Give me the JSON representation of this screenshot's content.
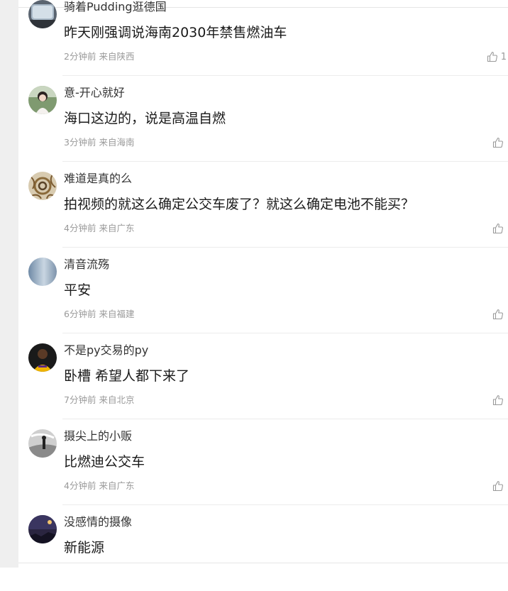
{
  "comments": [
    {
      "username": "骑着Pudding逛德国",
      "content": "昨天刚强调说海南2030年禁售燃油车",
      "time": "2分钟前",
      "location": "来自陕西",
      "likes": "1",
      "avatar": "avatar-car-window"
    },
    {
      "username": "意-开心就好",
      "content": "海口这边的，说是高温自燃",
      "time": "3分钟前",
      "location": "来自海南",
      "likes": "",
      "avatar": "avatar-girl"
    },
    {
      "username": "难道是真的么",
      "content": "拍视频的就这么确定公交车废了？就这么确定电池不能买？",
      "time": "4分钟前",
      "location": "来自广东",
      "likes": "",
      "avatar": "avatar-pattern"
    },
    {
      "username": "清音流殇",
      "content": "平安",
      "time": "6分钟前",
      "location": "来自福建",
      "likes": "",
      "avatar": "avatar-sky"
    },
    {
      "username": "不是py交易的py",
      "content": "卧槽 希望人都下来了",
      "time": "7分钟前",
      "location": "来自北京",
      "likes": "",
      "avatar": "avatar-player"
    },
    {
      "username": "摄尖上的小贩",
      "content": "比燃迪公交车",
      "time": "4分钟前",
      "location": "来自广东",
      "likes": "",
      "avatar": "avatar-bw"
    },
    {
      "username": "没感情的摄像",
      "content": "新能源",
      "time": "",
      "location": "",
      "likes": "",
      "avatar": "avatar-night"
    }
  ]
}
